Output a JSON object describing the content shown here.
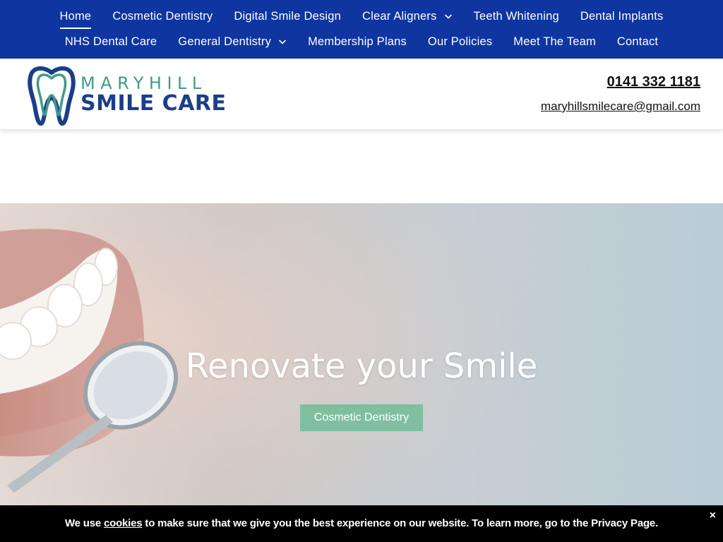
{
  "nav": {
    "row1": [
      {
        "label": "Home",
        "active": true
      },
      {
        "label": "Cosmetic Dentistry"
      },
      {
        "label": "Digital Smile Design"
      },
      {
        "label": "Clear Aligners",
        "dropdown": true
      },
      {
        "label": "Teeth Whitening"
      },
      {
        "label": "Dental Implants"
      }
    ],
    "row2": [
      {
        "label": "NHS Dental Care"
      },
      {
        "label": "General Dentistry",
        "dropdown": true
      },
      {
        "label": "Membership Plans"
      },
      {
        "label": "Our Policies"
      },
      {
        "label": "Meet The Team"
      },
      {
        "label": "Contact"
      }
    ]
  },
  "header": {
    "logo": {
      "line1": "MARYHILL",
      "line2": "SMILE CARE",
      "icon": "tooth-logo-icon"
    },
    "phone": "0141 332 1181",
    "email": "maryhillsmilecare@gmail.com"
  },
  "hero": {
    "title": "Renovate your Smile",
    "button_label": "Cosmetic Dentistry"
  },
  "cookie_bar": {
    "text_before": "We use ",
    "link_label": "cookies",
    "text_after": " to make sure that we give you the best experience on our website. To learn more, go to the Privacy Page.",
    "close_label": "×"
  },
  "colors": {
    "nav_bg": "#0e35a0",
    "logo_teal": "#3f9a8c",
    "logo_navy": "#1b3f87",
    "button_green": "#7fbf9f",
    "cookie_bg": "#000000"
  }
}
